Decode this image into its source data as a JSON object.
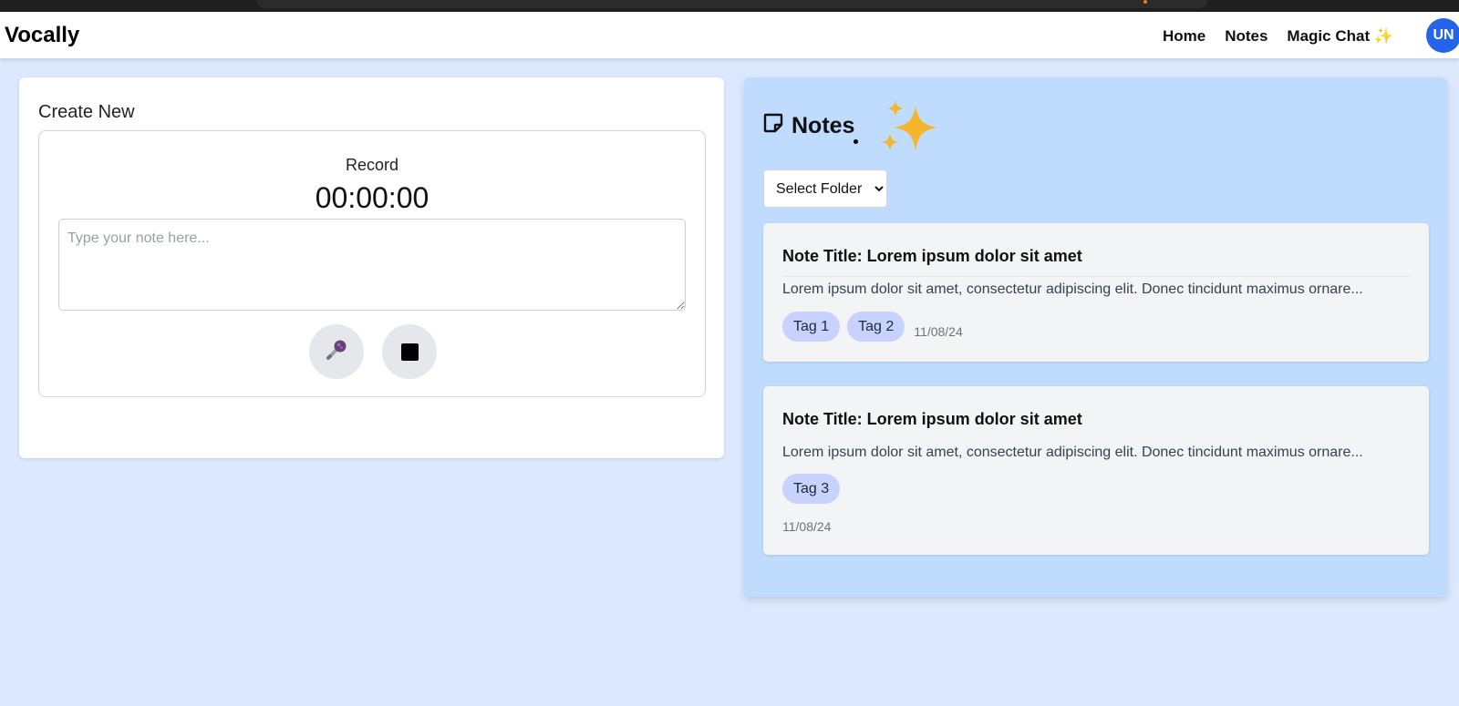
{
  "app": {
    "brand": "Vocally"
  },
  "nav": {
    "links": [
      {
        "label": "Home"
      },
      {
        "label": "Notes"
      },
      {
        "label": "Magic Chat ✨"
      }
    ],
    "avatar_initials": "UN"
  },
  "create": {
    "title": "Create New",
    "record_label": "Record",
    "timer": "00:00:00",
    "note_placeholder": "Type your note here...",
    "mic_icon": "🎤"
  },
  "notes_panel": {
    "title": "Notes",
    "folder_select": {
      "selected": "Select Folder"
    },
    "cards": [
      {
        "title": "Note Title: Lorem ipsum dolor sit amet",
        "body": "Lorem ipsum dolor sit amet, consectetur adipiscing elit. Donec tincidunt maximus ornare...",
        "tags": [
          "Tag 1",
          "Tag 2"
        ],
        "date": "11/08/24"
      },
      {
        "title": "Note Title: Lorem ipsum dolor sit amet",
        "body": "Lorem ipsum dolor sit amet, consectetur adipiscing elit. Donec tincidunt maximus ornare...",
        "tags": [
          "Tag 3"
        ],
        "date": "11/08/24"
      }
    ]
  },
  "colors": {
    "page_bg": "#dbe8fd",
    "panel_bg": "#bfdbfe",
    "tag_bg": "#c7d2fe",
    "avatar_bg": "#2563eb",
    "sparkle": "#f5b62f"
  },
  "icons": {
    "notes_header": "sticky-note-icon",
    "sparkle": "sparkle-icon",
    "mic": "microphone-icon",
    "stop": "stop-icon"
  }
}
